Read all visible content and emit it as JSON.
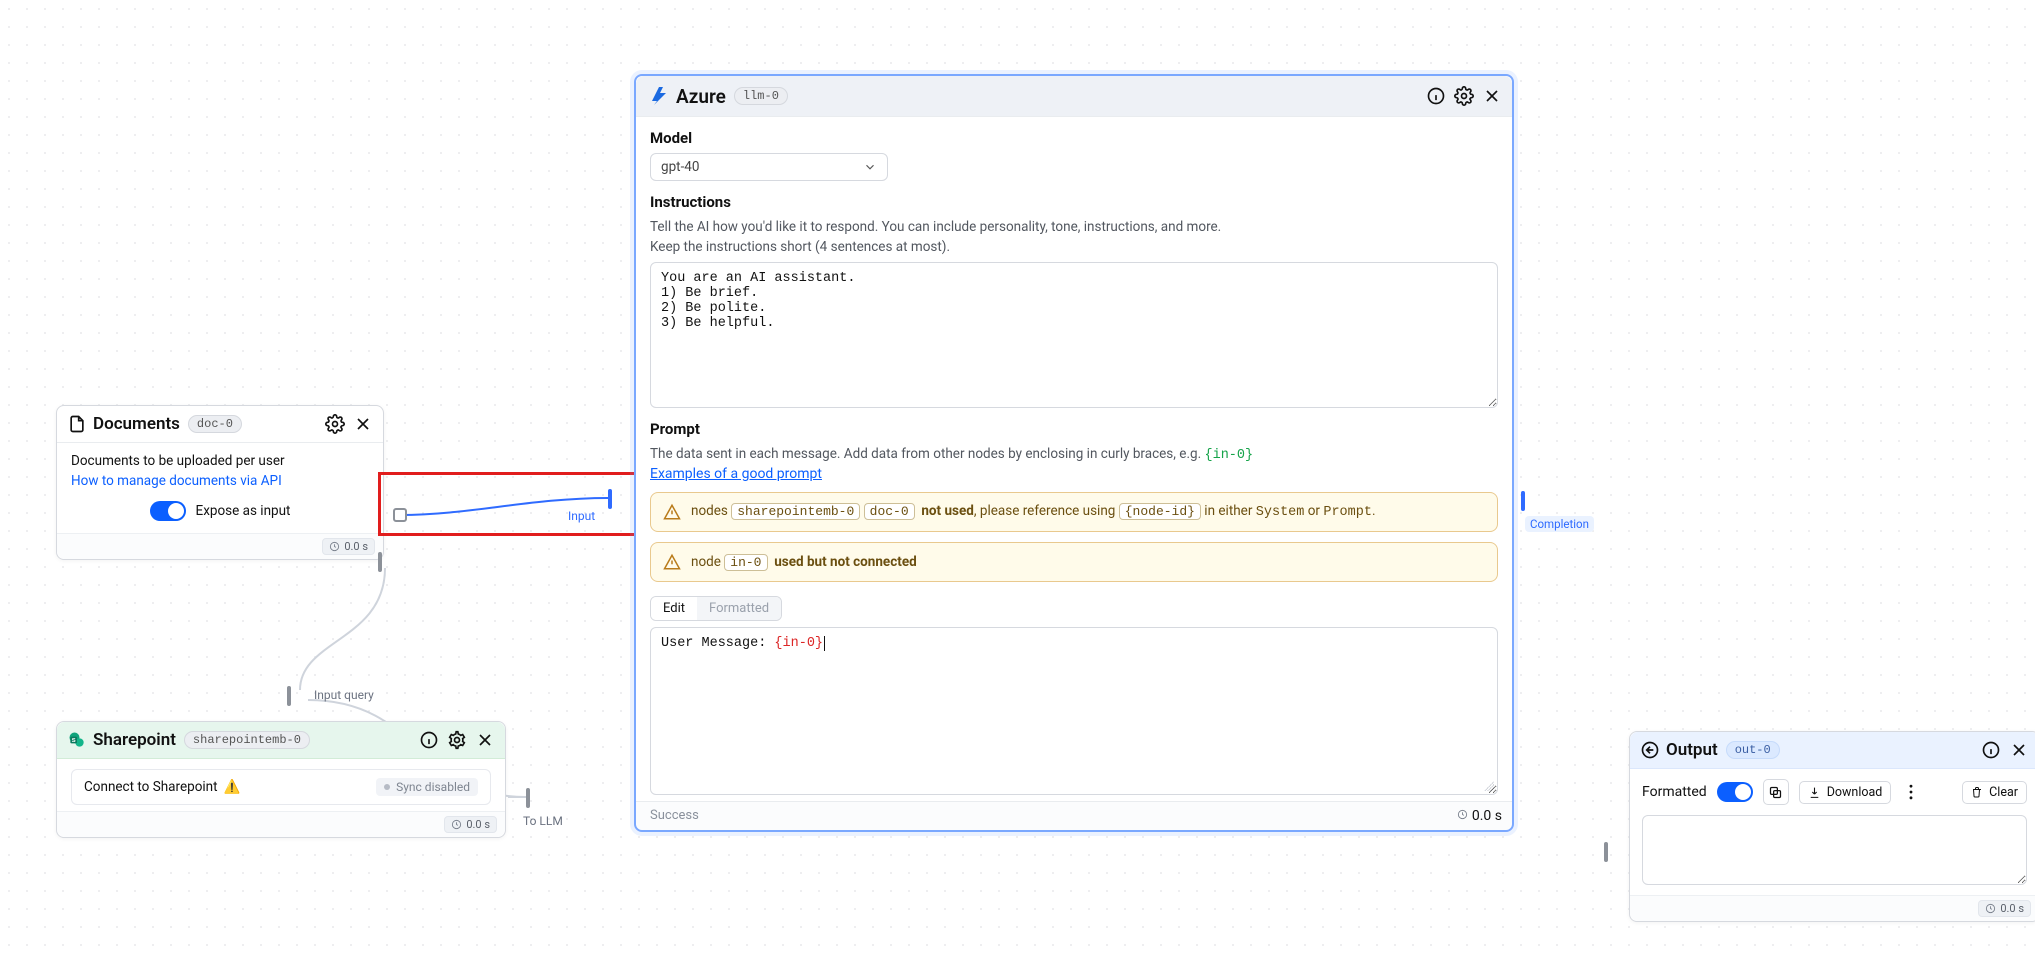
{
  "documents": {
    "title": "Documents",
    "tag": "doc-0",
    "desc": "Documents to be uploaded per user",
    "link_text": "How to manage documents via API",
    "expose_label": "Expose as input",
    "time": "0.0 s"
  },
  "port_labels": {
    "input": "Input",
    "input_query": "Input query",
    "to_llm": "To LLM",
    "completion": "Completion"
  },
  "sharepoint": {
    "title": "Sharepoint",
    "tag": "sharepointemb-0",
    "row_text": "Connect to Sharepoint",
    "warning_emoji": "⚠️",
    "sync_badge": "Sync disabled",
    "time": "0.0 s"
  },
  "azure": {
    "title": "Azure",
    "tag": "llm-0",
    "model_label": "Model",
    "model_value": "gpt-40",
    "instructions_label": "Instructions",
    "instructions_desc_1": "Tell the AI how you'd like it to respond. You can include personality, tone, instructions, and more.",
    "instructions_desc_2": "Keep the instructions short (4 sentences at most).",
    "instructions_value": "You are an AI assistant.\n1) Be brief.\n2) Be polite.\n3) Be helpful.",
    "prompt_label": "Prompt",
    "prompt_desc_prefix": "The data sent in each message. Add data from other nodes by enclosing in curly braces, e.g. ",
    "prompt_desc_example": "{in-0}",
    "prompt_examples_link": "Examples of a good prompt",
    "alert1_pre": "nodes ",
    "alert1_chip1": "sharepointemb-0",
    "alert1_chip2": "doc-0",
    "alert1_strong": "not used",
    "alert1_mid": ", please reference using ",
    "alert1_chip3": "{node-id}",
    "alert1_tail_1": " in either ",
    "alert1_sys": "System",
    "alert1_tail_2": " or ",
    "alert1_prm": "Prompt",
    "alert1_period": ".",
    "alert2_pre": "node ",
    "alert2_chip": "in-0",
    "alert2_strong": "used but not connected",
    "tab_edit": "Edit",
    "tab_formatted": "Formatted",
    "prompt_value_pre": "User Message: ",
    "prompt_value_var": "{in-0}",
    "status": "Success",
    "time": "0.0 s"
  },
  "output": {
    "title": "Output",
    "tag": "out-0",
    "formatted_label": "Formatted",
    "download_label": "Download",
    "clear_label": "Clear",
    "time": "0.0 s"
  }
}
